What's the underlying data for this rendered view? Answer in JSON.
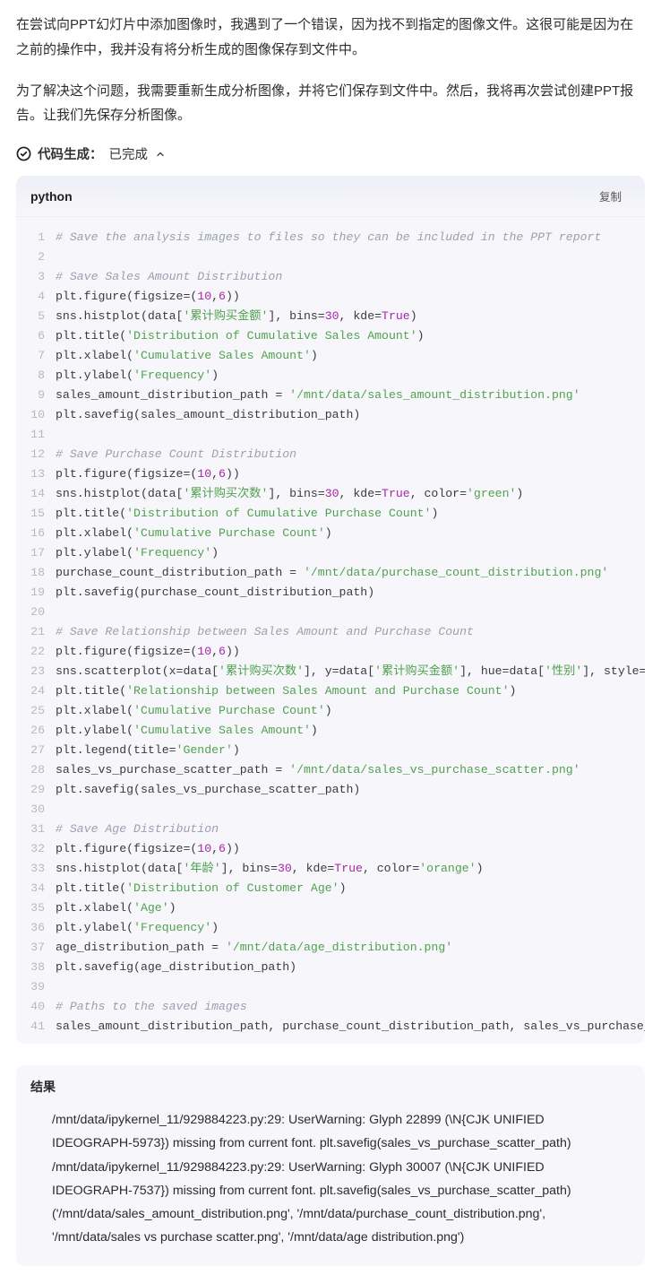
{
  "paragraphs": {
    "p1": "在尝试向PPT幻灯片中添加图像时，我遇到了一个错误，因为找不到指定的图像文件。这很可能是因为在之前的操作中，我并没有将分析生成的图像保存到文件中。",
    "p2": "为了解决这个问题，我需要重新生成分析图像，并将它们保存到文件中。然后，我将再次尝试创建PPT报告。让我们先保存分析图像。"
  },
  "status": {
    "label": "代码生成：",
    "value": "已完成"
  },
  "code": {
    "language": "python",
    "copy_label": "复制",
    "lines": [
      {
        "type": "com",
        "text": "# Save the analysis images to files so they can be included in the PPT report"
      },
      {
        "type": "blank",
        "text": ""
      },
      {
        "type": "com",
        "text": "# Save Sales Amount Distribution"
      },
      {
        "type": "code",
        "parts": [
          "plt.figure(figsize=(",
          {
            "t": "num",
            "v": "10"
          },
          ",",
          {
            "t": "num",
            "v": "6"
          },
          "))"
        ]
      },
      {
        "type": "code",
        "parts": [
          "sns.histplot(data[",
          {
            "t": "str",
            "v": "'累计购买金额'"
          },
          "], bins=",
          {
            "t": "num",
            "v": "30"
          },
          ", kde=",
          {
            "t": "kw",
            "v": "True"
          },
          ")"
        ]
      },
      {
        "type": "code",
        "parts": [
          "plt.title(",
          {
            "t": "str",
            "v": "'Distribution of Cumulative Sales Amount'"
          },
          ")"
        ]
      },
      {
        "type": "code",
        "parts": [
          "plt.xlabel(",
          {
            "t": "str",
            "v": "'Cumulative Sales Amount'"
          },
          ")"
        ]
      },
      {
        "type": "code",
        "parts": [
          "plt.ylabel(",
          {
            "t": "str",
            "v": "'Frequency'"
          },
          ")"
        ]
      },
      {
        "type": "code",
        "parts": [
          "sales_amount_distribution_path = ",
          {
            "t": "str",
            "v": "'/mnt/data/sales_amount_distribution.png'"
          }
        ]
      },
      {
        "type": "code",
        "parts": [
          "plt.savefig(sales_amount_distribution_path)"
        ]
      },
      {
        "type": "blank",
        "text": ""
      },
      {
        "type": "com",
        "text": "# Save Purchase Count Distribution"
      },
      {
        "type": "code",
        "parts": [
          "plt.figure(figsize=(",
          {
            "t": "num",
            "v": "10"
          },
          ",",
          {
            "t": "num",
            "v": "6"
          },
          "))"
        ]
      },
      {
        "type": "code",
        "parts": [
          "sns.histplot(data[",
          {
            "t": "str",
            "v": "'累计购买次数'"
          },
          "], bins=",
          {
            "t": "num",
            "v": "30"
          },
          ", kde=",
          {
            "t": "kw",
            "v": "True"
          },
          ", color=",
          {
            "t": "str",
            "v": "'green'"
          },
          ")"
        ]
      },
      {
        "type": "code",
        "parts": [
          "plt.title(",
          {
            "t": "str",
            "v": "'Distribution of Cumulative Purchase Count'"
          },
          ")"
        ]
      },
      {
        "type": "code",
        "parts": [
          "plt.xlabel(",
          {
            "t": "str",
            "v": "'Cumulative Purchase Count'"
          },
          ")"
        ]
      },
      {
        "type": "code",
        "parts": [
          "plt.ylabel(",
          {
            "t": "str",
            "v": "'Frequency'"
          },
          ")"
        ]
      },
      {
        "type": "code",
        "parts": [
          "purchase_count_distribution_path = ",
          {
            "t": "str",
            "v": "'/mnt/data/purchase_count_distribution.png'"
          }
        ]
      },
      {
        "type": "code",
        "parts": [
          "plt.savefig(purchase_count_distribution_path)"
        ]
      },
      {
        "type": "blank",
        "text": ""
      },
      {
        "type": "com",
        "text": "# Save Relationship between Sales Amount and Purchase Count"
      },
      {
        "type": "code",
        "parts": [
          "plt.figure(figsize=(",
          {
            "t": "num",
            "v": "10"
          },
          ",",
          {
            "t": "num",
            "v": "6"
          },
          "))"
        ]
      },
      {
        "type": "code",
        "parts": [
          "sns.scatterplot(x=data[",
          {
            "t": "str",
            "v": "'累计购买次数'"
          },
          "], y=data[",
          {
            "t": "str",
            "v": "'累计购买金额'"
          },
          "], hue=data[",
          {
            "t": "str",
            "v": "'性别'"
          },
          "], style="
        ]
      },
      {
        "type": "code",
        "parts": [
          "plt.title(",
          {
            "t": "str",
            "v": "'Relationship between Sales Amount and Purchase Count'"
          },
          ")"
        ]
      },
      {
        "type": "code",
        "parts": [
          "plt.xlabel(",
          {
            "t": "str",
            "v": "'Cumulative Purchase Count'"
          },
          ")"
        ]
      },
      {
        "type": "code",
        "parts": [
          "plt.ylabel(",
          {
            "t": "str",
            "v": "'Cumulative Sales Amount'"
          },
          ")"
        ]
      },
      {
        "type": "code",
        "parts": [
          "plt.legend(title=",
          {
            "t": "str",
            "v": "'Gender'"
          },
          ")"
        ]
      },
      {
        "type": "code",
        "parts": [
          "sales_vs_purchase_scatter_path = ",
          {
            "t": "str",
            "v": "'/mnt/data/sales_vs_purchase_scatter.png'"
          }
        ]
      },
      {
        "type": "code",
        "parts": [
          "plt.savefig(sales_vs_purchase_scatter_path)"
        ]
      },
      {
        "type": "blank",
        "text": ""
      },
      {
        "type": "com",
        "text": "# Save Age Distribution"
      },
      {
        "type": "code",
        "parts": [
          "plt.figure(figsize=(",
          {
            "t": "num",
            "v": "10"
          },
          ",",
          {
            "t": "num",
            "v": "6"
          },
          "))"
        ]
      },
      {
        "type": "code",
        "parts": [
          "sns.histplot(data[",
          {
            "t": "str",
            "v": "'年龄'"
          },
          "], bins=",
          {
            "t": "num",
            "v": "30"
          },
          ", kde=",
          {
            "t": "kw",
            "v": "True"
          },
          ", color=",
          {
            "t": "str",
            "v": "'orange'"
          },
          ")"
        ]
      },
      {
        "type": "code",
        "parts": [
          "plt.title(",
          {
            "t": "str",
            "v": "'Distribution of Customer Age'"
          },
          ")"
        ]
      },
      {
        "type": "code",
        "parts": [
          "plt.xlabel(",
          {
            "t": "str",
            "v": "'Age'"
          },
          ")"
        ]
      },
      {
        "type": "code",
        "parts": [
          "plt.ylabel(",
          {
            "t": "str",
            "v": "'Frequency'"
          },
          ")"
        ]
      },
      {
        "type": "code",
        "parts": [
          "age_distribution_path = ",
          {
            "t": "str",
            "v": "'/mnt/data/age_distribution.png'"
          }
        ]
      },
      {
        "type": "code",
        "parts": [
          "plt.savefig(age_distribution_path)"
        ]
      },
      {
        "type": "blank",
        "text": ""
      },
      {
        "type": "com",
        "text": "# Paths to the saved images"
      },
      {
        "type": "code",
        "parts": [
          "sales_amount_distribution_path, purchase_count_distribution_path, sales_vs_purchase_s"
        ]
      }
    ]
  },
  "result": {
    "title": "结果",
    "lines": [
      "/mnt/data/ipykernel_11/929884223.py:29: UserWarning: Glyph 22899 (\\N{CJK UNIFIED IDEOGRAPH-5973}) missing from current font. plt.savefig(sales_vs_purchase_scatter_path)",
      "/mnt/data/ipykernel_11/929884223.py:29: UserWarning: Glyph 30007 (\\N{CJK UNIFIED IDEOGRAPH-7537}) missing from current font. plt.savefig(sales_vs_purchase_scatter_path)",
      "('/mnt/data/sales_amount_distribution.png', '/mnt/data/purchase_count_distribution.png', '/mnt/data/sales vs purchase scatter.png', '/mnt/data/age distribution.png')"
    ]
  }
}
